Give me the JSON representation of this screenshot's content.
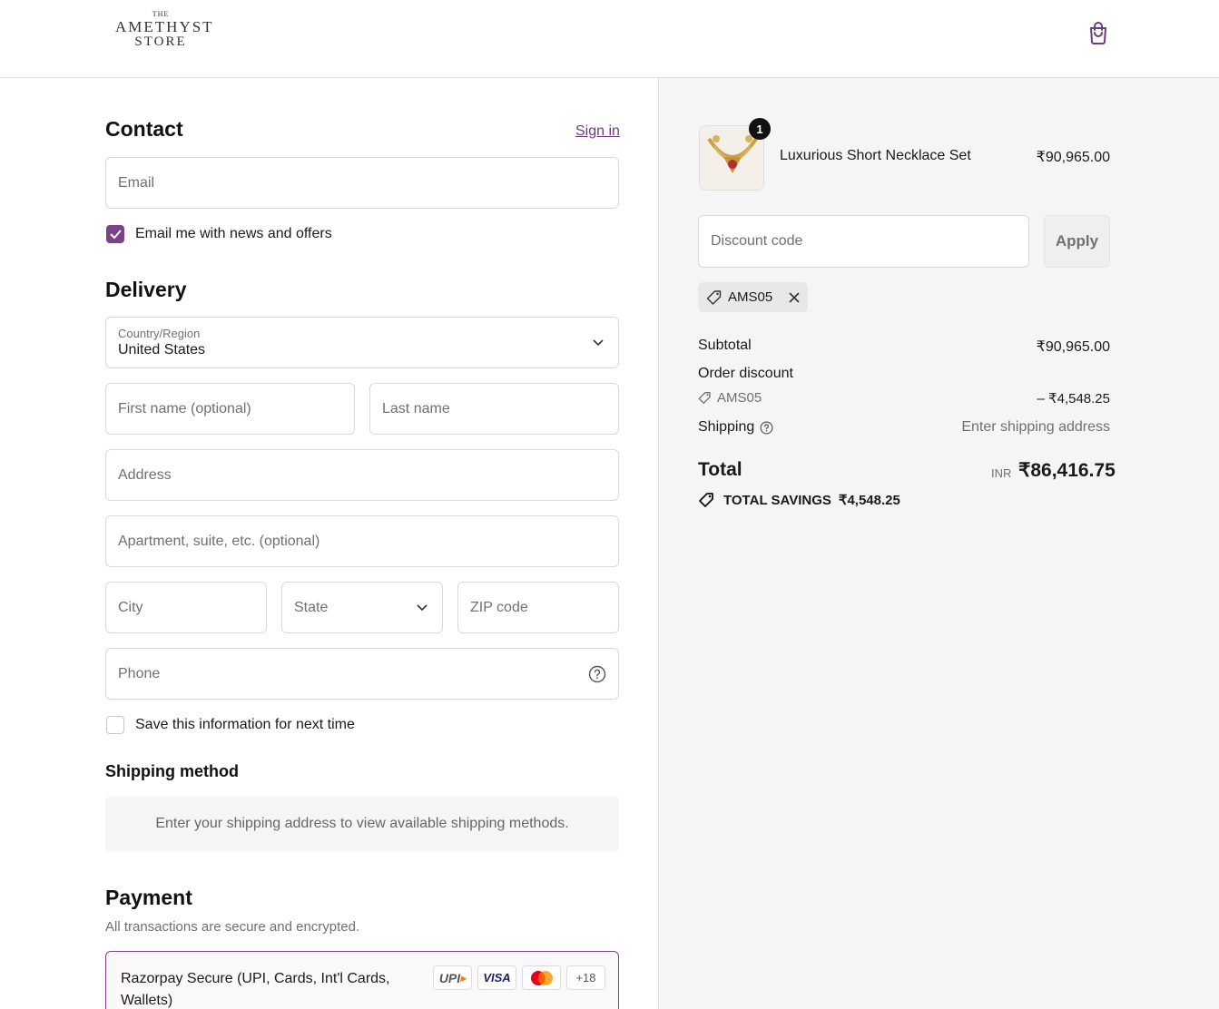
{
  "store": {
    "logo_line1": "THE",
    "logo_line2": "AMETHYST",
    "logo_line3": "STORE",
    "cart_icon": "shopping-bag-icon"
  },
  "contact": {
    "title": "Contact",
    "sign_in": "Sign in",
    "email_placeholder": "Email",
    "news_offers_label": "Email me with news and offers",
    "news_offers_checked": true
  },
  "delivery": {
    "title": "Delivery",
    "country_label": "Country/Region",
    "country_value": "United States",
    "first_name_placeholder": "First name (optional)",
    "last_name_placeholder": "Last name",
    "address_placeholder": "Address",
    "apartment_placeholder": "Apartment, suite, etc. (optional)",
    "city_placeholder": "City",
    "state_placeholder": "State",
    "zip_placeholder": "ZIP code",
    "phone_placeholder": "Phone",
    "save_info_label": "Save this information for next time",
    "save_info_checked": false
  },
  "shipping_method": {
    "title": "Shipping method",
    "note": "Enter your shipping address to view available shipping methods."
  },
  "payment": {
    "title": "Payment",
    "subtitle": "All transactions are secure and encrypted.",
    "option_label": "Razorpay Secure (UPI, Cards, Int'l Cards, Wallets)",
    "badges": {
      "upi": "UPI",
      "visa": "VISA",
      "more": "+18"
    }
  },
  "summary": {
    "product_name": "Luxurious Short Necklace Set",
    "product_qty": "1",
    "product_price": "₹90,965.00",
    "discount_placeholder": "Discount code",
    "apply_label": "Apply",
    "applied_code": "AMS05",
    "subtotal_label": "Subtotal",
    "subtotal_value": "₹90,965.00",
    "order_discount_label": "Order discount",
    "discount_code": "AMS05",
    "discount_value": "– ₹4,548.25",
    "shipping_label": "Shipping",
    "shipping_value": "Enter shipping address",
    "total_label": "Total",
    "total_currency": "INR",
    "total_value": "₹86,416.75",
    "savings_label": "TOTAL SAVINGS",
    "savings_value": "₹4,548.25"
  },
  "colors": {
    "accent": "#7a4288",
    "link": "#6e3b7e",
    "summary_bg": "#f5f5f5"
  }
}
